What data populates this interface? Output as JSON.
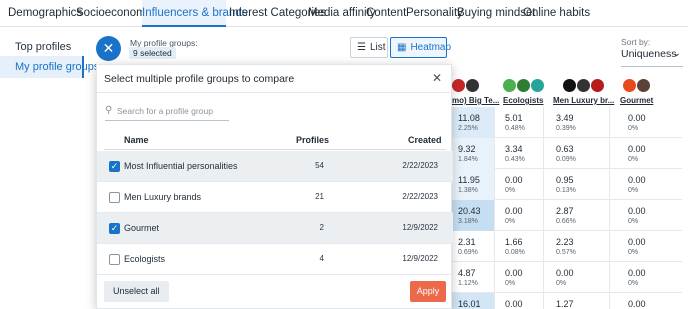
{
  "nav": {
    "tabs": [
      {
        "label": "Demographics"
      },
      {
        "label": "Socioeconomics"
      },
      {
        "label": "Influencers & brands",
        "active": true
      },
      {
        "label": "Interest Categories"
      },
      {
        "label": "Media affinity"
      },
      {
        "label": "Content"
      },
      {
        "label": "Personality"
      },
      {
        "label": "Buying mindset"
      },
      {
        "label": "Online habits"
      }
    ]
  },
  "sidebar": {
    "items": [
      {
        "label": "Top profiles"
      },
      {
        "label": "My profile groups",
        "active": true
      }
    ]
  },
  "profile_groups": {
    "label": "My profile groups:",
    "badge": "9 selected",
    "close_icon": "close-icon"
  },
  "view": {
    "list_label": "List",
    "heatmap_label": "Heatmap",
    "active": "Heatmap"
  },
  "sort": {
    "label": "Sort by:",
    "value": "Uniqueness"
  },
  "columns": [
    {
      "name": "mo) Big Te...",
      "logo_colors": [
        "#c62828",
        "#333333"
      ]
    },
    {
      "name": "Ecologists",
      "logo_colors": [
        "#4caf50",
        "#2e7d32",
        "#26a69a"
      ]
    },
    {
      "name": "Men Luxury br...",
      "logo_colors": [
        "#111111",
        "#333333",
        "#b71c1c"
      ]
    },
    {
      "name": "Gourmet",
      "logo_colors": [
        "#e64a19",
        "#5d4037"
      ]
    }
  ],
  "heatmap_rows": [
    [
      {
        "v": "11.08",
        "p": "2.25%",
        "hi": "#dcebf7"
      },
      {
        "v": "5.01",
        "p": "0.48%"
      },
      {
        "v": "3.49",
        "p": "0.39%"
      },
      {
        "v": "0.00",
        "p": "0%"
      }
    ],
    [
      {
        "v": "9.32",
        "p": "1.84%",
        "hi": "#e8f2fa"
      },
      {
        "v": "3.34",
        "p": "0.43%"
      },
      {
        "v": "0.63",
        "p": "0.09%"
      },
      {
        "v": "0.00",
        "p": "0%"
      }
    ],
    [
      {
        "v": "11.95",
        "p": "1.38%",
        "hi": "#e8f2fa"
      },
      {
        "v": "0.00",
        "p": "0%"
      },
      {
        "v": "0.95",
        "p": "0.13%"
      },
      {
        "v": "0.00",
        "p": "0%"
      }
    ],
    [
      {
        "v": "20.43",
        "p": "3.18%",
        "hi": "#c5def2"
      },
      {
        "v": "0.00",
        "p": "0%"
      },
      {
        "v": "2.87",
        "p": "0.66%"
      },
      {
        "v": "0.00",
        "p": "0%"
      }
    ],
    [
      {
        "v": "2.31",
        "p": "0.69%"
      },
      {
        "v": "1.66",
        "p": "0.08%"
      },
      {
        "v": "2.23",
        "p": "0.57%"
      },
      {
        "v": "0.00",
        "p": "0%"
      }
    ],
    [
      {
        "v": "4.87",
        "p": "1.12%"
      },
      {
        "v": "0.00",
        "p": "0%"
      },
      {
        "v": "0.00",
        "p": "0%"
      },
      {
        "v": "0.00",
        "p": "0%"
      }
    ],
    [
      {
        "v": "16.01",
        "p": "3.09%",
        "hi": "#d3e6f5"
      },
      {
        "v": "0.00",
        "p": "0%"
      },
      {
        "v": "1.27",
        "p": "0.23%"
      },
      {
        "v": "0.00",
        "p": "0%"
      }
    ]
  ],
  "modal": {
    "title": "Select multiple profile groups to compare",
    "search_placeholder": "Search for a profile group",
    "headers": {
      "name": "Name",
      "profiles": "Profiles",
      "created": "Created"
    },
    "rows": [
      {
        "name": "Most Influential personalities",
        "profiles": "54",
        "created": "2/22/2023",
        "checked": true
      },
      {
        "name": "Men Luxury brands",
        "profiles": "21",
        "created": "2/22/2023",
        "checked": false
      },
      {
        "name": "Gourmet",
        "profiles": "2",
        "created": "12/9/2022",
        "checked": true
      },
      {
        "name": "Ecologists",
        "profiles": "4",
        "created": "12/9/2022",
        "checked": false
      }
    ],
    "unselect_label": "Unselect all",
    "apply_label": "Apply"
  },
  "colors": {
    "accent": "#1a73c8",
    "apply": "#ec6a4a"
  }
}
